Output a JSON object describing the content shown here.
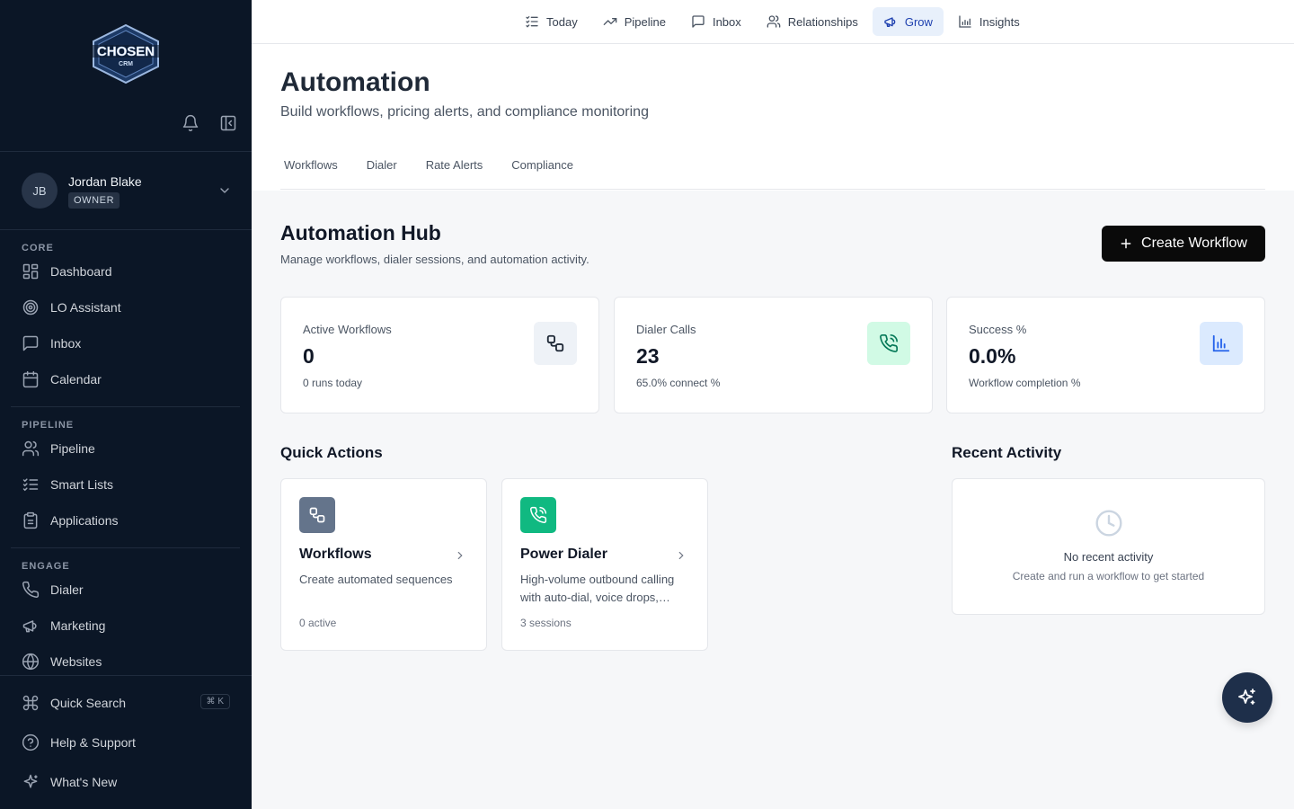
{
  "brand": {
    "logo_line1": "CHOSEN",
    "logo_line2": "CRM"
  },
  "user": {
    "initials": "JB",
    "name": "Jordan Blake",
    "role": "OWNER"
  },
  "sidebar": {
    "sections": [
      {
        "label": "CORE",
        "items": [
          {
            "label": "Dashboard",
            "icon": "dashboard-icon"
          },
          {
            "label": "LO Assistant",
            "icon": "target-icon"
          },
          {
            "label": "Inbox",
            "icon": "message-icon"
          },
          {
            "label": "Calendar",
            "icon": "calendar-icon"
          }
        ]
      },
      {
        "label": "PIPELINE",
        "items": [
          {
            "label": "Pipeline",
            "icon": "users-icon"
          },
          {
            "label": "Smart Lists",
            "icon": "list-check-icon"
          },
          {
            "label": "Applications",
            "icon": "clipboard-icon"
          }
        ]
      },
      {
        "label": "ENGAGE",
        "items": [
          {
            "label": "Dialer",
            "icon": "phone-icon"
          },
          {
            "label": "Marketing",
            "icon": "megaphone-icon"
          },
          {
            "label": "Websites",
            "icon": "globe-icon"
          }
        ]
      }
    ],
    "footer": [
      {
        "label": "Quick Search",
        "icon": "command-icon",
        "shortcut": "⌘ K"
      },
      {
        "label": "Help & Support",
        "icon": "help-icon"
      },
      {
        "label": "What's New",
        "icon": "sparkle-icon"
      }
    ]
  },
  "topnav": [
    {
      "label": "Today",
      "icon": "list-icon",
      "active": false
    },
    {
      "label": "Pipeline",
      "icon": "trend-icon",
      "active": false
    },
    {
      "label": "Inbox",
      "icon": "message-icon",
      "active": false
    },
    {
      "label": "Relationships",
      "icon": "users-icon",
      "active": false
    },
    {
      "label": "Grow",
      "icon": "megaphone-icon",
      "active": true
    },
    {
      "label": "Insights",
      "icon": "bar-chart-icon",
      "active": false
    }
  ],
  "header": {
    "title": "Automation",
    "subtitle": "Build workflows, pricing alerts, and compliance monitoring",
    "tabs": [
      "Workflows",
      "Dialer",
      "Rate Alerts",
      "Compliance"
    ]
  },
  "hub": {
    "title": "Automation Hub",
    "subtitle": "Manage workflows, dialer sessions, and automation activity.",
    "create_label": "Create Workflow"
  },
  "stats": [
    {
      "label": "Active Workflows",
      "value": "0",
      "sub": "0 runs today",
      "icon": "workflow-icon",
      "icon_bg": "#eef2f7",
      "icon_color": "#1f2937"
    },
    {
      "label": "Dialer Calls",
      "value": "23",
      "sub": "65.0% connect %",
      "icon": "phone-call-icon",
      "icon_bg": "#d1fae5",
      "icon_color": "#047857"
    },
    {
      "label": "Success %",
      "value": "0.0%",
      "sub": "Workflow completion %",
      "icon": "bar-chart-icon",
      "icon_bg": "#dbeafe",
      "icon_color": "#2563eb"
    }
  ],
  "quick_actions": {
    "title": "Quick Actions",
    "items": [
      {
        "name": "Workflows",
        "desc": "Create automated sequences",
        "meta": "0 active",
        "tile_color": "#64748b"
      },
      {
        "name": "Power Dialer",
        "desc": "High-volume outbound calling with auto-dial, voice drops,…",
        "meta": "3 sessions",
        "tile_color": "#10b981"
      }
    ]
  },
  "recent_activity": {
    "title": "Recent Activity",
    "empty_title": "No recent activity",
    "empty_sub": "Create and run a workflow to get started"
  }
}
